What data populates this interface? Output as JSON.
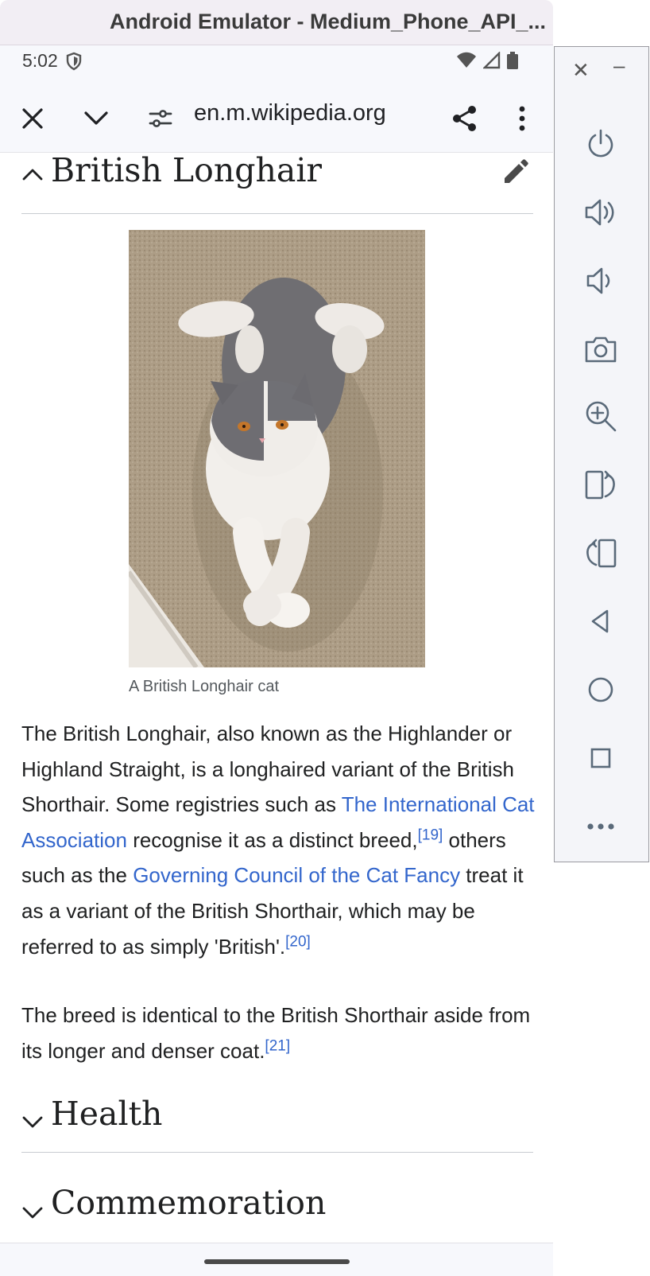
{
  "window": {
    "title": "Android Emulator - Medium_Phone_API_..."
  },
  "status_bar": {
    "time": "5:02"
  },
  "browser": {
    "url": "en.m.wikipedia.org"
  },
  "article": {
    "section_title": "British Longhair",
    "image_caption": "A British Longhair cat",
    "para1": {
      "t1": "The British Longhair, also known as the Highlander or Highland Straight, is a longhaired variant of the British Shorthair. Some registries such as ",
      "link1": "The International Cat Association",
      "t2": " recognise it as a distinct breed,",
      "ref1": "[19]",
      "t3": " others such as the ",
      "link2": "Governing Council of the Cat Fancy",
      "t4": " treat it as a variant of the British Shorthair, which may be referred to as simply 'British'.",
      "ref2": "[20]"
    },
    "para2": {
      "t1": "The breed is identical to the British Shorthair aside from its longer and denser coat.",
      "ref1": "[21]"
    },
    "sections": [
      "Health",
      "Commemoration"
    ]
  },
  "side_toolbar": {
    "buttons": [
      "power",
      "volume-up",
      "volume-down",
      "camera",
      "zoom",
      "rotate-left",
      "rotate-right",
      "back",
      "home",
      "overview",
      "more"
    ]
  },
  "colors": {
    "link": "#3366cc",
    "text": "#202122",
    "title_bar": "#f2eef4"
  }
}
